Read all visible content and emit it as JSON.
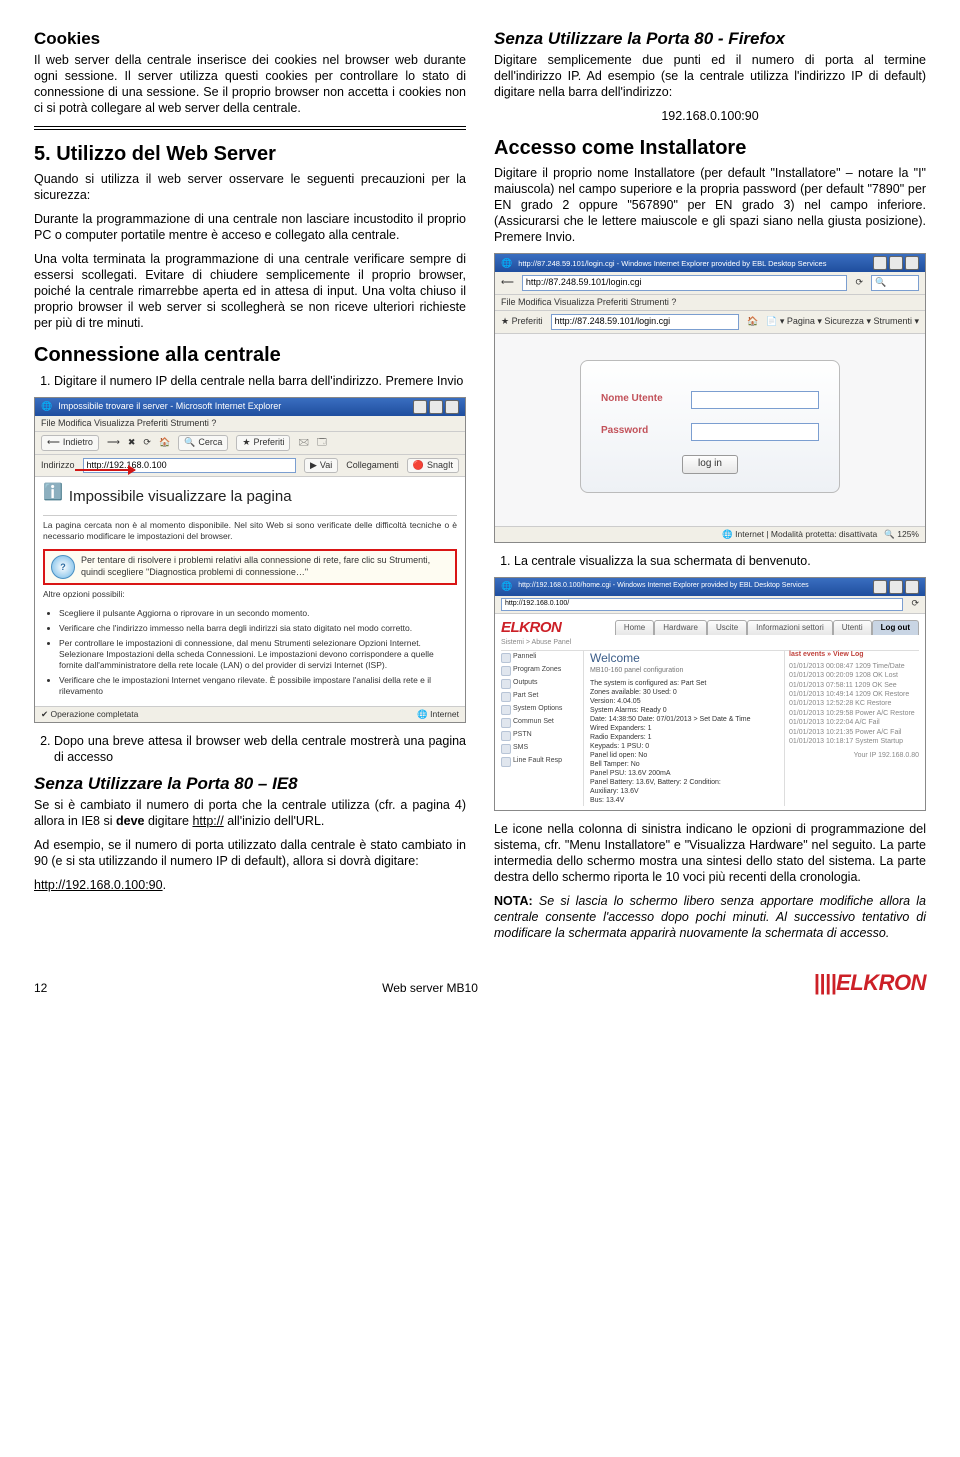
{
  "left": {
    "cookies_h": "Cookies",
    "cookies_p": "Il web server della centrale inserisce dei cookies nel browser web durante ogni sessione. Il server utilizza questi cookies per controllare lo stato di connessione di una sessione. Se il proprio browser non accetta i cookies non ci si potrà collegare al web server della centrale.",
    "sect5_h": "5. Utilizzo del Web Server",
    "sect5_intro": "Quando si utilizza il web server osservare le seguenti precauzioni per la sicurezza:",
    "sect5_p2": "Durante la programmazione di una centrale non lasciare incustodito il proprio PC o computer portatile mentre è acceso e collegato alla centrale.",
    "sect5_p3": "Una volta terminata la programmazione di una centrale verificare sempre di essersi scollegati. Evitare di chiudere semplicemente il proprio browser, poiché la centrale rimarrebbe aperta ed in attesa di input. Una volta chiuso il proprio browser il web server si scollegherà se non riceve ulteriori richieste per più di tre minuti.",
    "conn_h": "Connessione alla centrale",
    "conn_li1": "Digitare il numero IP della centrale nella barra dell'indirizzo. Premere Invio",
    "fig1": {
      "title": "Impossibile trovare il server - Microsoft Internet Explorer",
      "menu": "File   Modifica   Visualizza   Preferiti   Strumenti   ?",
      "tb_back": "Indietro",
      "tb_search": "Cerca",
      "tb_fav": "Preferiti",
      "addr_lbl": "Indirizzo",
      "addr_val": "http://192.168.0.100",
      "addr_go": "Vai",
      "addr_links": "Collegamenti",
      "addr_snag": "SnagIt",
      "h": "Impossibile visualizzare la pagina",
      "p1": "La pagina cercata non è al momento disponibile. Nel sito Web si sono verificate delle difficoltà tecniche o è necessario modificare le impostazioni del browser.",
      "help": "Per tentare di risolvere i problemi relativi alla connessione di rete, fare clic su Strumenti, quindi scegliere \"Diagnostica problemi di connessione…\"",
      "other": "Altre opzioni possibili:",
      "b1": "Scegliere il pulsante  Aggiorna o riprovare in un secondo momento.",
      "b2": "Verificare che l'indirizzo immesso nella barra degli indirizzi sia stato digitato nel modo corretto.",
      "b3": "Per controllare le impostazioni di connessione, dal menu Strumenti selezionare Opzioni Internet. Selezionare Impostazioni della scheda Connessioni. Le impostazioni devono corrispondere a quelle fornite dall'amministratore della rete locale (LAN) o del provider di servizi Internet (ISP).",
      "b4": "Verificare che le impostazioni Internet vengano rilevate. È possibile impostare l'analisi della rete e il rilevamento",
      "status_l": "Operazione completata",
      "status_r": "Internet"
    },
    "li2": "Dopo una breve attesa il browser web della centrale mostrerà una pagina di accesso",
    "ie8_h": "Senza Utilizzare la Porta 80 – IE8",
    "ie8_p1a": "Se si è cambiato il numero di porta che la centrale utilizza (cfr.  a pagina 4) allora in IE8 si ",
    "ie8_p1b": "deve",
    "ie8_p1c": " digitare ",
    "ie8_p1d": "http://",
    "ie8_p1e": " all'inizio dell'URL.",
    "ie8_p2": "Ad esempio, se il numero di porta utilizzato dalla centrale è stato cambiato in 90 (e si sta utilizzando il numero IP di default), allora si dovrà digitare:",
    "ie8_url": "http://192.168.0.100:90"
  },
  "right": {
    "ff_h": "Senza Utilizzare la Porta 80 - Firefox",
    "ff_p": "Digitare semplicemente due punti ed il numero di porta al termine dell'indirizzo IP. Ad esempio (se la centrale utilizza l'indirizzo IP di default) digitare nella barra dell'indirizzo:",
    "ff_ip": "192.168.0.100:90",
    "inst_h": "Accesso come Installatore",
    "inst_p": "Digitare il proprio nome Installatore (per default \"Installatore\" – notare la \"I\" maiuscola) nel campo superiore e la propria password (per default \"7890\" per EN grado 2 oppure \"567890\" per EN grado 3) nel campo inferiore. (Assicurarsi che le lettere maiuscole e gli spazi siano nella giusta posizione). Premere Invio.",
    "fig_login": {
      "title": "http://87.248.59.101/login.cgi - Windows Internet Explorer provided by EBL Desktop Services",
      "url": "http://87.248.59.101/login.cgi",
      "menu": "File   Modifica   Visualizza   Preferiti   Strumenti   ?",
      "addr2": "http://87.248.59.101/login.cgi",
      "nome": "Nome Utente",
      "pass": "Password",
      "login": "log in",
      "status_l": "Internet | Modalità protetta: disattivata",
      "status_r": "125%"
    },
    "li1": "La centrale visualizza la sua schermata di benvenuto.",
    "fig_welcome": {
      "title": "http://192.168.0.100/home.cgi - Windows Internet Explorer provided by EBL Desktop Services",
      "brand": "ELKRON",
      "tabs": [
        "Home",
        "Hardware",
        "Uscite",
        "Informazioni settori",
        "Utenti",
        "Log out"
      ],
      "panel_sub": "Sistemi > Abuse Panel",
      "h": "Welcome",
      "sub": "MB10-160 panel configuration",
      "side": [
        "Panneli",
        "Program Zones",
        "Outputs",
        "Part Set",
        "System Options",
        "Commun Set",
        "PSTN",
        "SMS",
        "Line Fault Resp"
      ],
      "facts": [
        "The system is configured as: Part Set",
        "Zones available: 30  Used: 0",
        "Version: 4.04.05",
        "System Alarms: Ready 0",
        "Date: 14:38:50  Date: 07/01/2013 > Set Date & Time",
        "Wired Expanders: 1",
        "Radio Expanders: 1",
        "Keypads: 1  PSU: 0",
        "",
        "Panel lid open: No",
        "Bell Tamper: No",
        "",
        "Panel PSU: 13.6V  200mA",
        "Panel Battery: 13.6V, Battery: 2  Condition:",
        "Auxiliary: 13.6V",
        "Bus: 13.4V"
      ],
      "events_h": "last events » View Log",
      "events": [
        "01/01/2013  00:08:47  1209 Time/Date",
        "01/01/2013  00:20:09  1208 OK Lost",
        "01/01/2013  07:58:11  1209 OK See",
        "01/01/2013  10:49:14  1209 OK Restore",
        "01/01/2013  12:52:28  KC Restore",
        "01/01/2013  10:29:58  Power A/C Restore",
        "01/01/2013  10:22:04  A/C Fail",
        "01/01/2013  10:21:35  Power A/C Fail",
        "01/01/2013  10:18:17  System Startup"
      ],
      "your_ip": "Your IP  192.168.0.80"
    },
    "para_icons": "Le icone nella colonna di sinistra indicano le opzioni di programmazione del sistema, cfr. \"Menu Installatore\" e \"Visualizza Hardware\" nel seguito. La parte intermedia dello schermo mostra una sintesi dello stato del sistema. La parte destra dello schermo riporta le 10 voci più recenti della cronologia.",
    "nota_lbl": "NOTA:",
    "nota_txt": " Se si lascia lo schermo libero senza apportare modifiche allora la centrale consente l'accesso dopo pochi minuti. Al successivo tentativo di modificare la schermata apparirà nuovamente la schermata di accesso."
  },
  "footer": {
    "page": "12",
    "mid": "Web server MB10",
    "brand": "ELKRON"
  }
}
